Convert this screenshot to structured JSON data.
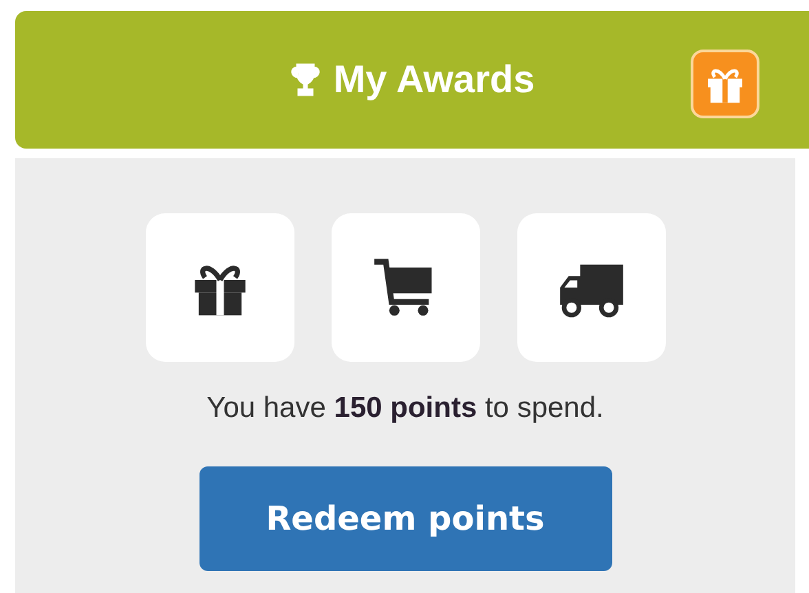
{
  "header": {
    "title": "My Awards"
  },
  "tiles": [
    {
      "kind": "gift"
    },
    {
      "kind": "cart"
    },
    {
      "kind": "truck"
    }
  ],
  "summary": "You have **150 points** to spend.",
  "button": "Redeem points"
}
